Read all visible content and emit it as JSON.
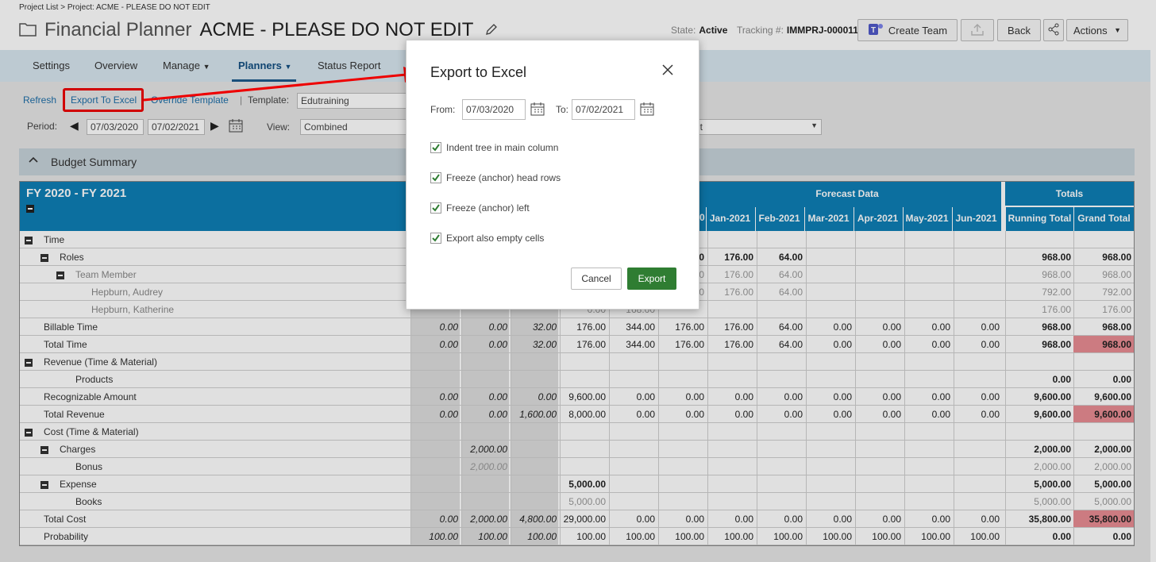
{
  "breadcrumb": "Project List > Project: ACME - PLEASE DO NOT EDIT",
  "title": {
    "app": "Financial Planner",
    "project": "ACME - PLEASE DO NOT EDIT"
  },
  "state": {
    "label": "State:",
    "value": "Active"
  },
  "tracking": {
    "label": "Tracking #:",
    "value": "IMMPRJ-000011"
  },
  "header_buttons": {
    "create_team": "Create Team",
    "back": "Back",
    "actions": "Actions"
  },
  "nav": [
    "Settings",
    "Overview",
    "Manage",
    "Planners",
    "Status Report"
  ],
  "toolbar": {
    "refresh": "Refresh",
    "export": "Export To Excel",
    "override": "Override Template",
    "sep": "|",
    "template_label": "Template:",
    "template_value": "Edutraining",
    "period_label": "Period:",
    "period_from": "07/03/2020",
    "period_to": "07/02/2021",
    "view_label": "View:",
    "view_value": "Combined",
    "right_select_value": "nt"
  },
  "section_title": "Budget Summary",
  "grid": {
    "title": "FY 2020 - FY 2021",
    "forecast_label": "Forecast Data",
    "totals_label": "Totals",
    "months": [
      "Jan-2021",
      "Feb-2021",
      "Mar-2021",
      "Apr-2021",
      "May-2021",
      "Jun-2021"
    ],
    "partial_month_tail": "0",
    "total_cols": [
      "Running Total",
      "Grand Total"
    ],
    "rows": [
      {
        "label": "Time",
        "level": 0,
        "toggle": true,
        "bold": false,
        "dim": false,
        "cells": [
          "",
          "",
          "",
          "",
          "",
          "",
          "",
          "",
          "",
          "",
          "",
          "",
          "",
          ""
        ]
      },
      {
        "label": "Roles",
        "level": 1,
        "toggle": true,
        "bold": false,
        "dim": false,
        "cells": [
          "",
          "",
          "",
          "",
          "",
          "0",
          "176.00",
          "64.00",
          "",
          "",
          "",
          "",
          "968.00",
          "968.00"
        ]
      },
      {
        "label": "Team Member",
        "level": 2,
        "toggle": true,
        "bold": false,
        "dim": true,
        "cells": [
          "",
          "",
          "",
          "",
          "",
          "0",
          "176.00",
          "64.00",
          "",
          "",
          "",
          "",
          "968.00",
          "968.00"
        ]
      },
      {
        "label": "Hepburn, Audrey",
        "level": 3,
        "toggle": false,
        "bold": false,
        "dim": true,
        "cells": [
          "",
          "",
          "",
          "",
          "",
          "0",
          "176.00",
          "64.00",
          "",
          "",
          "",
          "",
          "792.00",
          "792.00"
        ]
      },
      {
        "label": "Hepburn, Katherine",
        "level": 3,
        "toggle": false,
        "bold": false,
        "dim": true,
        "cells": [
          "",
          "",
          "",
          "0.00",
          "168.00",
          "",
          "",
          "",
          "",
          "",
          "",
          "",
          "176.00",
          "176.00"
        ]
      },
      {
        "label": "Billable Time",
        "level": 0,
        "toggle": false,
        "bold": false,
        "dim": false,
        "cells": [
          "0.00",
          "0.00",
          "32.00",
          "176.00",
          "344.00",
          "176.00",
          "176.00",
          "64.00",
          "0.00",
          "0.00",
          "0.00",
          "0.00",
          "968.00",
          "968.00"
        ]
      },
      {
        "label": "Total Time",
        "level": 0,
        "toggle": false,
        "bold": false,
        "dim": false,
        "cells": [
          "0.00",
          "0.00",
          "32.00",
          "176.00",
          "344.00",
          "176.00",
          "176.00",
          "64.00",
          "0.00",
          "0.00",
          "0.00",
          "0.00",
          "968.00",
          "968.00"
        ],
        "flag": true
      },
      {
        "label": "Revenue (Time & Material)",
        "level": 0,
        "toggle": true,
        "bold": false,
        "dim": false,
        "cells": [
          "",
          "",
          "",
          "",
          "",
          "",
          "",
          "",
          "",
          "",
          "",
          "",
          "",
          ""
        ]
      },
      {
        "label": "Products",
        "level": 1,
        "toggle": false,
        "bold": false,
        "dim": false,
        "cells": [
          "",
          "",
          "",
          "",
          "",
          "",
          "",
          "",
          "",
          "",
          "",
          "",
          "0.00",
          "0.00"
        ]
      },
      {
        "label": "Recognizable Amount",
        "level": 0,
        "toggle": false,
        "bold": false,
        "dim": false,
        "cells": [
          "0.00",
          "0.00",
          "0.00",
          "9,600.00",
          "0.00",
          "0.00",
          "0.00",
          "0.00",
          "0.00",
          "0.00",
          "0.00",
          "0.00",
          "9,600.00",
          "9,600.00"
        ]
      },
      {
        "label": "Total Revenue",
        "level": 0,
        "toggle": false,
        "bold": false,
        "dim": false,
        "cells": [
          "0.00",
          "0.00",
          "1,600.00",
          "8,000.00",
          "0.00",
          "0.00",
          "0.00",
          "0.00",
          "0.00",
          "0.00",
          "0.00",
          "0.00",
          "9,600.00",
          "9,600.00"
        ],
        "flag": true
      },
      {
        "label": "Cost (Time & Material)",
        "level": 0,
        "toggle": true,
        "bold": false,
        "dim": false,
        "cells": [
          "",
          "",
          "",
          "",
          "",
          "",
          "",
          "",
          "",
          "",
          "",
          "",
          "",
          ""
        ]
      },
      {
        "label": "Charges",
        "level": 1,
        "toggle": true,
        "bold": false,
        "dim": false,
        "cells": [
          "",
          "2,000.00",
          "",
          "",
          "",
          "",
          "",
          "",
          "",
          "",
          "",
          "",
          "2,000.00",
          "2,000.00"
        ]
      },
      {
        "label": "Bonus",
        "level": 2,
        "toggle": false,
        "bold": false,
        "dim": false,
        "cells": [
          "",
          "2,000.00",
          "",
          "",
          "",
          "",
          "",
          "",
          "",
          "",
          "",
          "",
          "2,000.00",
          "2,000.00"
        ]
      },
      {
        "label": "Expense",
        "level": 1,
        "toggle": true,
        "bold": false,
        "dim": false,
        "cells": [
          "",
          "",
          "",
          "5,000.00",
          "",
          "",
          "",
          "",
          "",
          "",
          "",
          "",
          "5,000.00",
          "5,000.00"
        ]
      },
      {
        "label": "Books",
        "level": 2,
        "toggle": false,
        "bold": false,
        "dim": false,
        "cells": [
          "",
          "",
          "",
          "5,000.00",
          "",
          "",
          "",
          "",
          "",
          "",
          "",
          "",
          "5,000.00",
          "5,000.00"
        ]
      },
      {
        "label": "Total Cost",
        "level": 0,
        "toggle": false,
        "bold": false,
        "dim": false,
        "cells": [
          "0.00",
          "2,000.00",
          "4,800.00",
          "29,000.00",
          "0.00",
          "0.00",
          "0.00",
          "0.00",
          "0.00",
          "0.00",
          "0.00",
          "0.00",
          "35,800.00",
          "35,800.00"
        ],
        "flag": true
      },
      {
        "label": "Probability",
        "level": 0,
        "toggle": false,
        "bold": false,
        "dim": false,
        "cells": [
          "100.00",
          "100.00",
          "100.00",
          "100.00",
          "100.00",
          "100.00",
          "100.00",
          "100.00",
          "100.00",
          "100.00",
          "100.00",
          "100.00",
          "0.00",
          "0.00"
        ]
      }
    ]
  },
  "dialog": {
    "title": "Export to Excel",
    "from_label": "From:",
    "from_value": "07/03/2020",
    "to_label": "To:",
    "to_value": "07/02/2021",
    "options": [
      {
        "label": "Indent tree in main column",
        "checked": true
      },
      {
        "label": "Freeze (anchor) head rows",
        "checked": true
      },
      {
        "label": "Freeze (anchor) left",
        "checked": true
      },
      {
        "label": "Export also empty cells",
        "checked": true
      }
    ],
    "cancel": "Cancel",
    "export": "Export"
  },
  "colors": {
    "accent": "#0e7fb6",
    "nav": "#d8e6ef",
    "export_btn": "#2f7d32",
    "highlight": "#e8474d",
    "flag_cell": "#e98d93"
  }
}
